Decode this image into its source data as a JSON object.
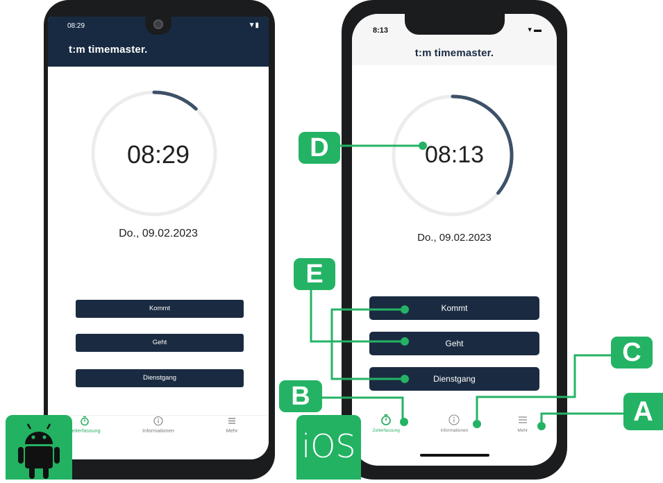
{
  "colors": {
    "navy": "#1a2b41",
    "green": "#24b364",
    "active_tab": "#2eae64",
    "progress": "#3d5168",
    "track": "#ececec"
  },
  "android": {
    "status_time": "08:29",
    "brand": "timemaster.",
    "logo_text": "t:m",
    "clock": "08:29",
    "date": "Do., 09.02.2023",
    "buttons": [
      "Kommt",
      "Geht",
      "Dienstgang"
    ],
    "tabs": [
      {
        "label": "Zeiterfassung",
        "icon": "stopwatch-icon"
      },
      {
        "label": "Informationen",
        "icon": "info-icon"
      },
      {
        "label": "Mehr",
        "icon": "menu-icon"
      }
    ],
    "progress_fraction": 0.12
  },
  "ios": {
    "status_time": "8:13",
    "brand": "timemaster.",
    "logo_text": "t:m",
    "clock": "08:13",
    "date": "Do., 09.02.2023",
    "buttons": [
      "Kommt",
      "Geht",
      "Dienstgang"
    ],
    "tabs": [
      {
        "label": "Zeiterfassung",
        "icon": "stopwatch-icon"
      },
      {
        "label": "Informationen",
        "icon": "info-icon"
      },
      {
        "label": "Mehr",
        "icon": "menu-icon"
      }
    ],
    "progress_fraction": 0.36
  },
  "callouts": {
    "a": "A",
    "b": "B",
    "c": "C",
    "d": "D",
    "e": "E"
  },
  "badges": {
    "android_icon": "android-robot-icon",
    "ios_label": "iOS"
  }
}
